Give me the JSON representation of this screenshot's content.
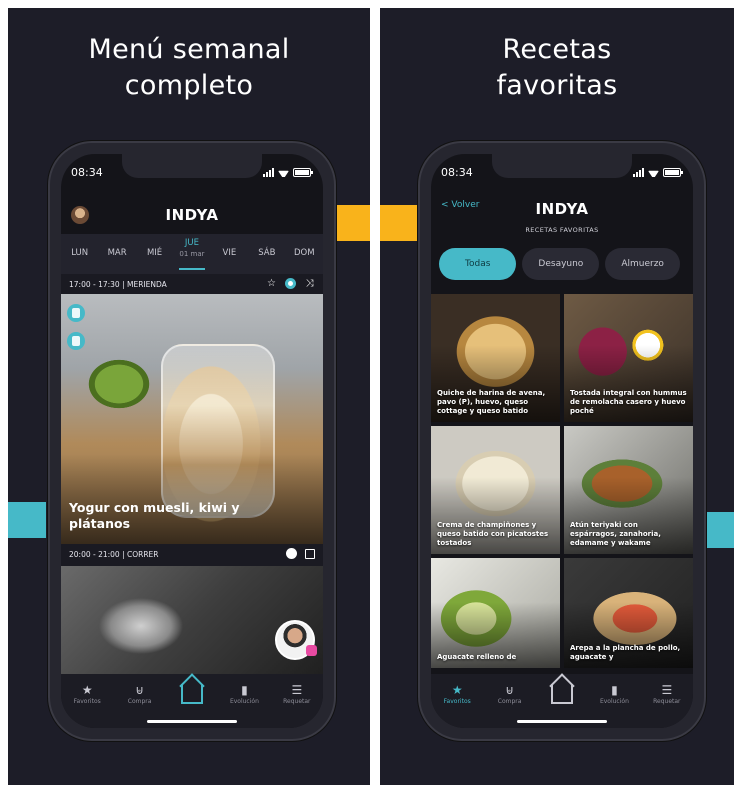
{
  "colors": {
    "accent_teal": "#46b9c8",
    "accent_orange": "#f9b31b",
    "panel_bg": "#1d1d28"
  },
  "left": {
    "headline": [
      "Menú semanal",
      "completo"
    ],
    "status_time": "08:34",
    "app_title": "INDYA",
    "days": [
      {
        "label": "LUN"
      },
      {
        "label": "MAR"
      },
      {
        "label": "MIÉ"
      },
      {
        "label": "JUE",
        "sub": "01 mar",
        "active": true
      },
      {
        "label": "VIE"
      },
      {
        "label": "SÁB"
      },
      {
        "label": "DOM"
      }
    ],
    "slot1_label": "17:00 - 17:30 | MERIENDA",
    "recipe_title": "Yogur con muesli, kiwi y plátanos",
    "slot2_label": "20:00 - 21:00 | CORRER",
    "tabs": [
      "Favoritos",
      "Compra",
      "",
      "Evolución",
      "Requetar"
    ]
  },
  "right": {
    "headline": [
      "Recetas",
      "favoritas"
    ],
    "status_time": "08:34",
    "back_label": "< Volver",
    "app_title": "INDYA",
    "subtitle": "RECETAS FAVORITAS",
    "chips": [
      "Todas",
      "Desayuno",
      "Almuerzo"
    ],
    "recipes": [
      "Quiche de harina de avena, pavo (P), huevo, queso cottage y queso batido",
      "Tostada integral con hummus de remolacha casero y huevo poché",
      "Crema de champiñones y queso batido con picatostes tostados",
      "Atún teriyaki con espárragos, zanahoria, edamame y wakame",
      "Aguacate relleno de",
      "Arepa a la plancha de pollo, aguacate y"
    ],
    "tabs": [
      "Favoritos",
      "Compra",
      "",
      "Evolución",
      "Requetar"
    ]
  }
}
